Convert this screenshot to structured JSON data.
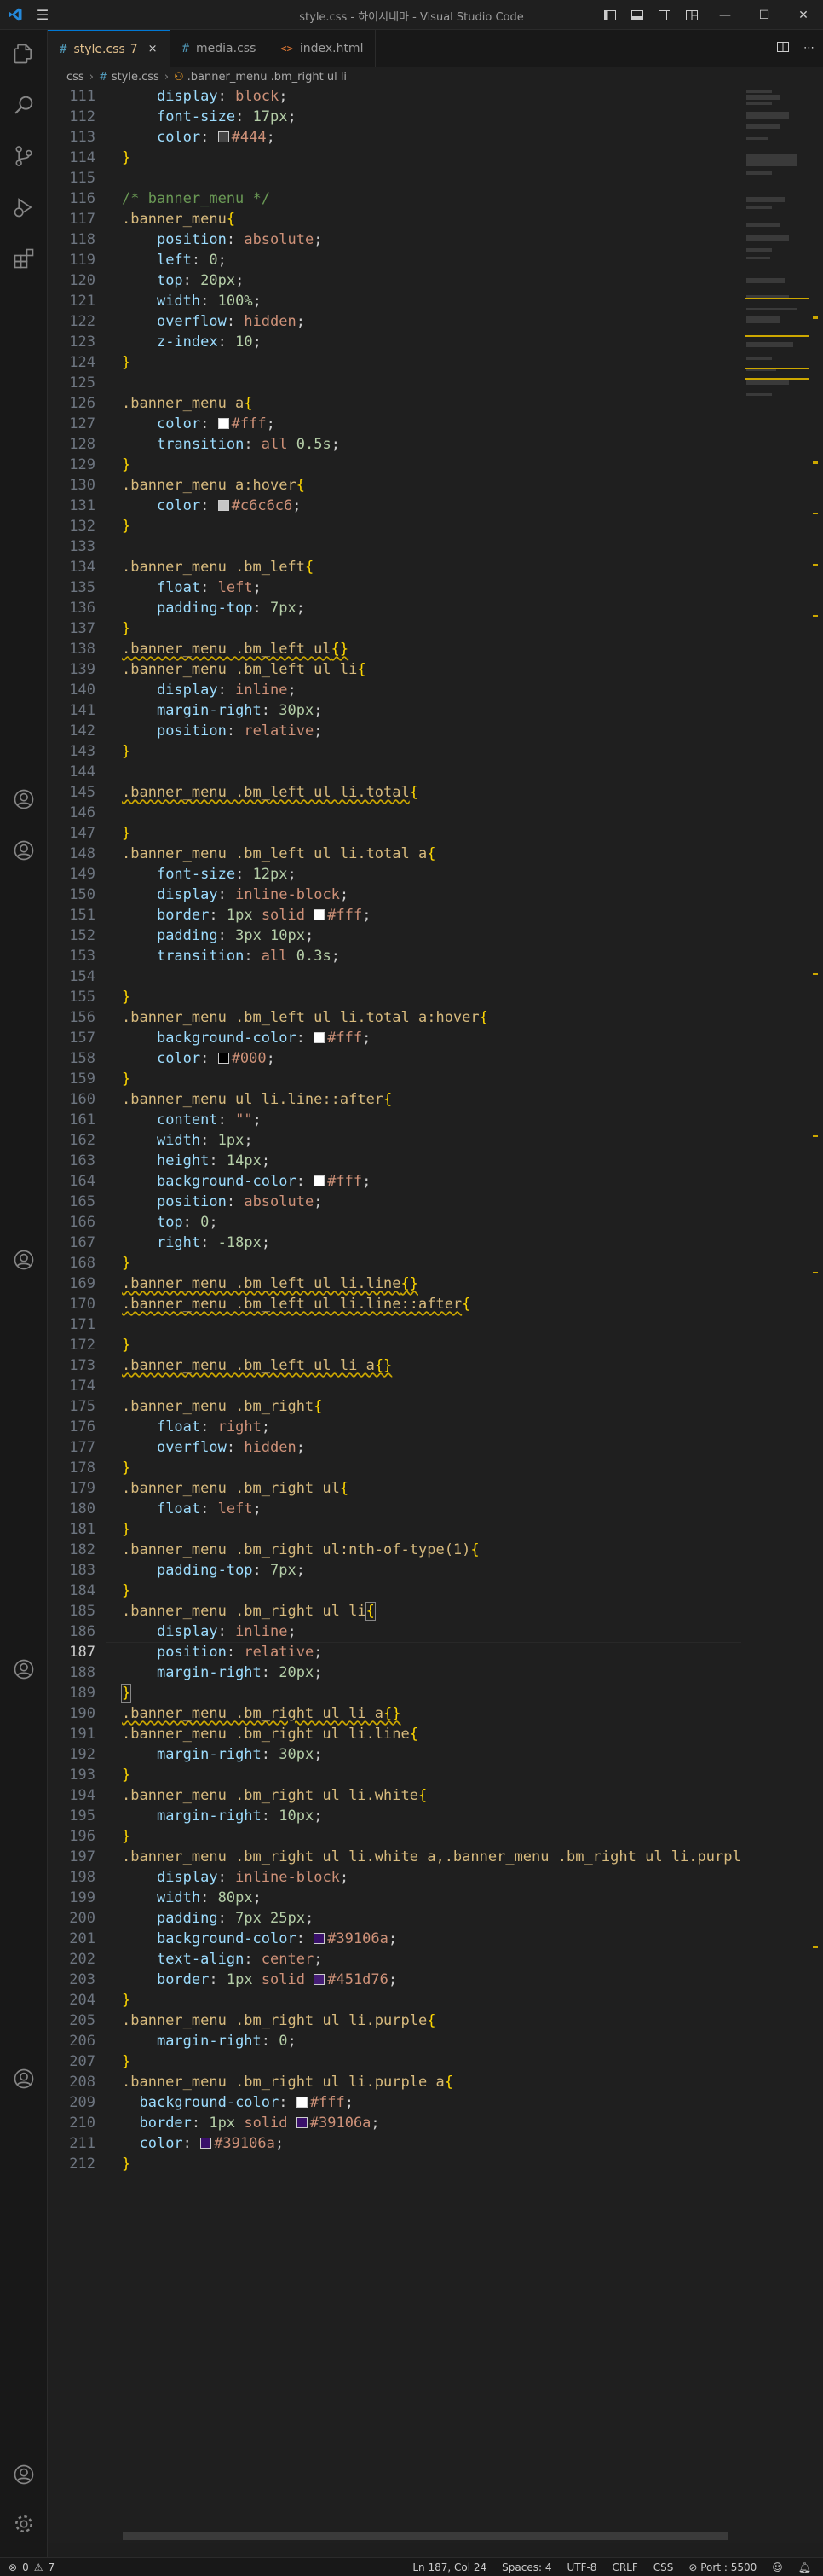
{
  "window": {
    "title": "style.css - 하이시네마 - Visual Studio Code"
  },
  "tabs": [
    {
      "icon": "#",
      "label": "style.css",
      "badge": "7",
      "active": true,
      "close": "×"
    },
    {
      "icon": "#",
      "label": "media.css",
      "badge": "",
      "active": false,
      "close": ""
    },
    {
      "icon": "<>",
      "label": "index.html",
      "badge": "",
      "active": false,
      "close": ""
    }
  ],
  "breadcrumb": {
    "folder": "css",
    "file": "style.css",
    "symbol": ".banner_menu .bm_right ul li"
  },
  "editor": {
    "current_line": 187,
    "lines": [
      {
        "n": "111",
        "html": "    <span class='prop'>display</span><span class='punc'>: </span><span class='val'>block</span><span class='punc'>;</span>"
      },
      {
        "n": "112",
        "html": "    <span class='prop'>font-size</span><span class='punc'>: </span><span class='num-v'>17px</span><span class='punc'>;</span>"
      },
      {
        "n": "113",
        "html": "    <span class='prop'>color</span><span class='punc'>: </span><span class='swatch' style='background:#444'></span><span class='val'>#444</span><span class='punc'>;</span>"
      },
      {
        "n": "114",
        "html": "<span class='brace'>}</span>"
      },
      {
        "n": "115",
        "html": ""
      },
      {
        "n": "116",
        "html": "<span class='cmt'>/* banner_menu */</span>"
      },
      {
        "n": "117",
        "html": "<span class='sel'>.banner_menu</span><span class='brace'>{</span>"
      },
      {
        "n": "118",
        "html": "    <span class='prop'>position</span><span class='punc'>: </span><span class='val'>absolute</span><span class='punc'>;</span>"
      },
      {
        "n": "119",
        "html": "    <span class='prop'>left</span><span class='punc'>: </span><span class='num-v'>0</span><span class='punc'>;</span>"
      },
      {
        "n": "120",
        "html": "    <span class='prop'>top</span><span class='punc'>: </span><span class='num-v'>20px</span><span class='punc'>;</span>"
      },
      {
        "n": "121",
        "html": "    <span class='prop'>width</span><span class='punc'>: </span><span class='num-v'>100%</span><span class='punc'>;</span>"
      },
      {
        "n": "122",
        "html": "    <span class='prop'>overflow</span><span class='punc'>: </span><span class='val'>hidden</span><span class='punc'>;</span>"
      },
      {
        "n": "123",
        "html": "    <span class='prop'>z-index</span><span class='punc'>: </span><span class='num-v'>10</span><span class='punc'>;</span>"
      },
      {
        "n": "124",
        "html": "<span class='brace'>}</span>"
      },
      {
        "n": "125",
        "html": ""
      },
      {
        "n": "126",
        "html": "<span class='sel'>.banner_menu a</span><span class='brace'>{</span>"
      },
      {
        "n": "127",
        "html": "    <span class='prop'>color</span><span class='punc'>: </span><span class='swatch' style='background:#fff'></span><span class='val'>#fff</span><span class='punc'>;</span>"
      },
      {
        "n": "128",
        "html": "    <span class='prop'>transition</span><span class='punc'>: </span><span class='val'>all </span><span class='num-v'>0.5s</span><span class='punc'>;</span>"
      },
      {
        "n": "129",
        "html": "<span class='brace'>}</span>"
      },
      {
        "n": "130",
        "html": "<span class='sel'>.banner_menu a:hover</span><span class='brace'>{</span>"
      },
      {
        "n": "131",
        "html": "    <span class='prop'>color</span><span class='punc'>: </span><span class='swatch' style='background:#c6c6c6'></span><span class='val'>#c6c6c6</span><span class='punc'>;</span>"
      },
      {
        "n": "132",
        "html": "<span class='brace'>}</span>"
      },
      {
        "n": "133",
        "html": ""
      },
      {
        "n": "134",
        "html": "<span class='sel'>.banner_menu .bm_left</span><span class='brace'>{</span>"
      },
      {
        "n": "135",
        "html": "    <span class='prop'>float</span><span class='punc'>: </span><span class='val'>left</span><span class='punc'>;</span>"
      },
      {
        "n": "136",
        "html": "    <span class='prop'>padding-top</span><span class='punc'>: </span><span class='num-v'>7px</span><span class='punc'>;</span>"
      },
      {
        "n": "137",
        "html": "<span class='brace'>}</span>"
      },
      {
        "n": "138",
        "html": "<span class='sel wavy'>.banner_menu .bm_left ul</span><span class='brace wavy'>{}</span>"
      },
      {
        "n": "139",
        "html": "<span class='sel'>.banner_menu .bm_left ul li</span><span class='brace'>{</span>"
      },
      {
        "n": "140",
        "html": "    <span class='prop'>display</span><span class='punc'>: </span><span class='val'>inline</span><span class='punc'>;</span>"
      },
      {
        "n": "141",
        "html": "    <span class='prop'>margin-right</span><span class='punc'>: </span><span class='num-v'>30px</span><span class='punc'>;</span>"
      },
      {
        "n": "142",
        "html": "    <span class='prop'>position</span><span class='punc'>: </span><span class='val'>relative</span><span class='punc'>;</span>"
      },
      {
        "n": "143",
        "html": "<span class='brace'>}</span>"
      },
      {
        "n": "144",
        "html": ""
      },
      {
        "n": "145",
        "html": "<span class='sel wavy'>.banner_menu .bm_left ul li.total</span><span class='brace'>{</span>"
      },
      {
        "n": "146",
        "html": ""
      },
      {
        "n": "147",
        "html": "<span class='brace'>}</span>"
      },
      {
        "n": "148",
        "html": "<span class='sel'>.banner_menu .bm_left ul li.total a</span><span class='brace'>{</span>"
      },
      {
        "n": "149",
        "html": "    <span class='prop'>font-size</span><span class='punc'>: </span><span class='num-v'>12px</span><span class='punc'>;</span>"
      },
      {
        "n": "150",
        "html": "    <span class='prop'>display</span><span class='punc'>: </span><span class='val'>inline-block</span><span class='punc'>;</span>"
      },
      {
        "n": "151",
        "html": "    <span class='prop'>border</span><span class='punc'>: </span><span class='num-v'>1px</span><span class='val'> solid </span><span class='swatch' style='background:#fff'></span><span class='val'>#fff</span><span class='punc'>;</span>"
      },
      {
        "n": "152",
        "html": "    <span class='prop'>padding</span><span class='punc'>: </span><span class='num-v'>3px 10px</span><span class='punc'>;</span>"
      },
      {
        "n": "153",
        "html": "    <span class='prop'>transition</span><span class='punc'>: </span><span class='val'>all </span><span class='num-v'>0.3s</span><span class='punc'>;</span>"
      },
      {
        "n": "154",
        "html": ""
      },
      {
        "n": "155",
        "html": "<span class='brace'>}</span>"
      },
      {
        "n": "156",
        "html": "<span class='sel'>.banner_menu .bm_left ul li.total a:hover</span><span class='brace'>{</span>"
      },
      {
        "n": "157",
        "html": "    <span class='prop'>background-color</span><span class='punc'>: </span><span class='swatch' style='background:#fff'></span><span class='val'>#fff</span><span class='punc'>;</span>"
      },
      {
        "n": "158",
        "html": "    <span class='prop'>color</span><span class='punc'>: </span><span class='swatch' style='background:#000'></span><span class='val'>#000</span><span class='punc'>;</span>"
      },
      {
        "n": "159",
        "html": "<span class='brace'>}</span>"
      },
      {
        "n": "160",
        "html": "<span class='sel'>.banner_menu ul li.line::after</span><span class='brace'>{</span>"
      },
      {
        "n": "161",
        "html": "    <span class='prop'>content</span><span class='punc'>: </span><span class='val'>\"\"</span><span class='punc'>;</span>"
      },
      {
        "n": "162",
        "html": "    <span class='prop'>width</span><span class='punc'>: </span><span class='num-v'>1px</span><span class='punc'>;</span>"
      },
      {
        "n": "163",
        "html": "    <span class='prop'>height</span><span class='punc'>: </span><span class='num-v'>14px</span><span class='punc'>;</span>"
      },
      {
        "n": "164",
        "html": "    <span class='prop'>background-color</span><span class='punc'>: </span><span class='swatch' style='background:#fff'></span><span class='val'>#fff</span><span class='punc'>;</span>"
      },
      {
        "n": "165",
        "html": "    <span class='prop'>position</span><span class='punc'>: </span><span class='val'>absolute</span><span class='punc'>;</span>"
      },
      {
        "n": "166",
        "html": "    <span class='prop'>top</span><span class='punc'>: </span><span class='num-v'>0</span><span class='punc'>;</span>"
      },
      {
        "n": "167",
        "html": "    <span class='prop'>right</span><span class='punc'>: </span><span class='num-v'>-18px</span><span class='punc'>;</span>"
      },
      {
        "n": "168",
        "html": "<span class='brace'>}</span>"
      },
      {
        "n": "169",
        "html": "<span class='sel wavy'>.banner_menu .bm_left ul li.line</span><span class='brace wavy'>{}</span>"
      },
      {
        "n": "170",
        "html": "<span class='sel wavy'>.banner_menu .bm_left ul li.line::after</span><span class='brace'>{</span>"
      },
      {
        "n": "171",
        "html": ""
      },
      {
        "n": "172",
        "html": "<span class='brace'>}</span>"
      },
      {
        "n": "173",
        "html": "<span class='sel wavy'>.banner_menu .bm_left ul li a</span><span class='brace wavy'>{}</span>"
      },
      {
        "n": "174",
        "html": ""
      },
      {
        "n": "175",
        "html": "<span class='sel'>.banner_menu .bm_right</span><span class='brace'>{</span>"
      },
      {
        "n": "176",
        "html": "    <span class='prop'>float</span><span class='punc'>: </span><span class='val'>right</span><span class='punc'>;</span>"
      },
      {
        "n": "177",
        "html": "    <span class='prop'>overflow</span><span class='punc'>: </span><span class='val'>hidden</span><span class='punc'>;</span>"
      },
      {
        "n": "178",
        "html": "<span class='brace'>}</span>"
      },
      {
        "n": "179",
        "html": "<span class='sel'>.banner_menu .bm_right ul</span><span class='brace'>{</span>"
      },
      {
        "n": "180",
        "html": "    <span class='prop'>float</span><span class='punc'>: </span><span class='val'>left</span><span class='punc'>;</span>"
      },
      {
        "n": "181",
        "html": "<span class='brace'>}</span>"
      },
      {
        "n": "182",
        "html": "<span class='sel'>.banner_menu .bm_right ul:nth-of-type(1)</span><span class='brace'>{</span>"
      },
      {
        "n": "183",
        "html": "    <span class='prop'>padding-top</span><span class='punc'>: </span><span class='num-v'>7px</span><span class='punc'>;</span>"
      },
      {
        "n": "184",
        "html": "<span class='brace'>}</span>"
      },
      {
        "n": "185",
        "html": "<span class='sel'>.banner_menu .bm_right ul li</span><span class='brace' style='outline:1px solid #888'>{</span>"
      },
      {
        "n": "186",
        "html": "    <span class='prop'>display</span><span class='punc'>: </span><span class='val'>inline</span><span class='punc'>;</span>"
      },
      {
        "n": "187",
        "html": "    <span class='prop'>position</span><span class='punc'>: </span><span class='val'>relative</span><span class='punc'>;</span>"
      },
      {
        "n": "188",
        "html": "    <span class='prop'>margin-right</span><span class='punc'>: </span><span class='num-v'>20px</span><span class='punc'>;</span>"
      },
      {
        "n": "189",
        "html": "<span class='brace' style='outline:1px solid #888'>}</span>"
      },
      {
        "n": "190",
        "html": "<span class='sel wavy'>.banner_menu .bm_right ul li a</span><span class='brace wavy'>{}</span>"
      },
      {
        "n": "191",
        "html": "<span class='sel'>.banner_menu .bm_right ul li.line</span><span class='brace'>{</span>"
      },
      {
        "n": "192",
        "html": "    <span class='prop'>margin-right</span><span class='punc'>: </span><span class='num-v'>30px</span><span class='punc'>;</span>"
      },
      {
        "n": "193",
        "html": "<span class='brace'>}</span>"
      },
      {
        "n": "194",
        "html": "<span class='sel'>.banner_menu .bm_right ul li.white</span><span class='brace'>{</span>"
      },
      {
        "n": "195",
        "html": "    <span class='prop'>margin-right</span><span class='punc'>: </span><span class='num-v'>10px</span><span class='punc'>;</span>"
      },
      {
        "n": "196",
        "html": "<span class='brace'>}</span>"
      },
      {
        "n": "197",
        "html": "<span class='sel'>.banner_menu .bm_right ul li.white a,.banner_menu .bm_right ul li.purple</span>"
      },
      {
        "n": "198",
        "html": "    <span class='prop'>display</span><span class='punc'>: </span><span class='val'>inline-block</span><span class='punc'>;</span>"
      },
      {
        "n": "199",
        "html": "    <span class='prop'>width</span><span class='punc'>: </span><span class='num-v'>80px</span><span class='punc'>;</span>"
      },
      {
        "n": "200",
        "html": "    <span class='prop'>padding</span><span class='punc'>: </span><span class='num-v'>7px 25px</span><span class='punc'>;</span>"
      },
      {
        "n": "201",
        "html": "    <span class='prop'>background-color</span><span class='punc'>: </span><span class='swatch' style='background:#39106a'></span><span class='val'>#39106a</span><span class='punc'>;</span>"
      },
      {
        "n": "202",
        "html": "    <span class='prop'>text-align</span><span class='punc'>: </span><span class='val'>center</span><span class='punc'>;</span>"
      },
      {
        "n": "203",
        "html": "    <span class='prop'>border</span><span class='punc'>: </span><span class='num-v'>1px</span><span class='val'> solid </span><span class='swatch' style='background:#451d76'></span><span class='val'>#451d76</span><span class='punc'>;</span>"
      },
      {
        "n": "204",
        "html": "<span class='brace'>}</span>"
      },
      {
        "n": "205",
        "html": "<span class='sel'>.banner_menu .bm_right ul li.purple</span><span class='brace'>{</span>"
      },
      {
        "n": "206",
        "html": "    <span class='prop'>margin-right</span><span class='punc'>: </span><span class='num-v'>0</span><span class='punc'>;</span>"
      },
      {
        "n": "207",
        "html": "<span class='brace'>}</span>"
      },
      {
        "n": "208",
        "html": "<span class='sel'>.banner_menu .bm_right ul li.purple a</span><span class='brace'>{</span>"
      },
      {
        "n": "209",
        "html": "  <span class='prop'>background-color</span><span class='punc'>: </span><span class='swatch' style='background:#fff'></span><span class='val'>#fff</span><span class='punc'>;</span>"
      },
      {
        "n": "210",
        "html": "  <span class='prop'>border</span><span class='punc'>: </span><span class='num-v'>1px</span><span class='val'> solid </span><span class='swatch' style='background:#39106a'></span><span class='val'>#39106a</span><span class='punc'>;</span>"
      },
      {
        "n": "211",
        "html": "  <span class='prop'>color</span><span class='punc'>: </span><span class='swatch' style='background:#39106a'></span><span class='val'>#39106a</span><span class='punc'>;</span>"
      },
      {
        "n": "212",
        "html": "<span class='brace'>}</span>"
      }
    ]
  },
  "status": {
    "errors": "0",
    "warnings": "7",
    "position": "Ln 187, Col 24",
    "spaces": "Spaces: 4",
    "encoding": "UTF-8",
    "eol": "CRLF",
    "language": "CSS",
    "port": "Port : 5500"
  }
}
